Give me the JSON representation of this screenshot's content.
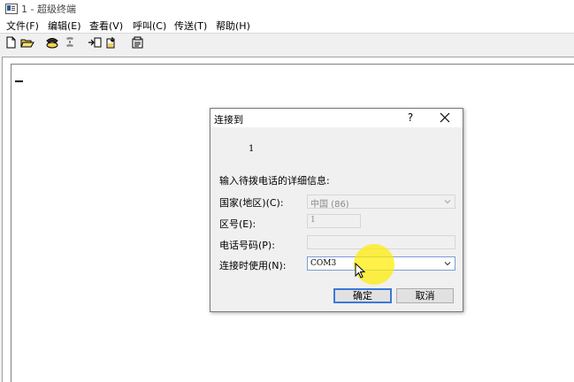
{
  "window": {
    "title": "1 - 超级终端"
  },
  "menu": [
    "文件(F)",
    "编辑(E)",
    "查看(V)",
    "呼叫(C)",
    "传送(T)",
    "帮助(H)"
  ],
  "toolbar": {
    "icons": [
      "new-icon",
      "open-icon",
      "call-icon",
      "disconnect-icon",
      "send-icon",
      "receive-icon",
      "properties-icon"
    ]
  },
  "terminal": {
    "caret": "_"
  },
  "dialog": {
    "title": "连接到",
    "help": "?",
    "connection_name": "1",
    "instruction": "输入待拨电话的详细信息:",
    "country_label": "国家(地区)(C):",
    "country_value": "中国 (86)",
    "area_code_label": "区号(E):",
    "area_code_value": "1",
    "phone_label": "电话号码(P):",
    "phone_value": "",
    "connect_using_label": "连接时使用(N):",
    "connect_using_value": "COM3",
    "ok_label": "确定",
    "cancel_label": "取消"
  },
  "colors": {
    "accent": "#3c78d8",
    "highlight": "#ffec00"
  }
}
